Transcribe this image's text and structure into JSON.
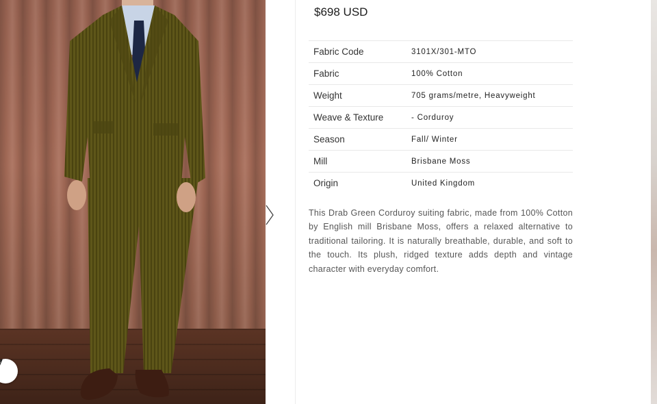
{
  "product": {
    "price": "$698 USD",
    "specs": [
      {
        "label": "Fabric Code",
        "value": "3101X/301-MTO"
      },
      {
        "label": "Fabric",
        "value": "100% Cotton"
      },
      {
        "label": "Weight",
        "value": "705 grams/metre, Heavyweight"
      },
      {
        "label": "Weave & Texture",
        "value": "- Corduroy"
      },
      {
        "label": "Season",
        "value": "Fall/ Winter"
      },
      {
        "label": "Mill",
        "value": "Brisbane Moss"
      },
      {
        "label": "Origin",
        "value": "United Kingdom"
      }
    ],
    "description": "This Drab Green Corduroy suiting fabric, made from 100% Cotton by English mill Brisbane Moss, offers a relaxed alternative to traditional tailoring. It is naturally breathable, durable, and soft to the touch. Its plush, ridged texture adds depth and vintage character with everyday comfort."
  },
  "gallery": {
    "share_icon": "send-icon",
    "next_icon": "chevron-right-icon"
  },
  "colors": {
    "suit": "#5c5418",
    "curtain": "#9b6452",
    "floor": "#4a2c20"
  }
}
